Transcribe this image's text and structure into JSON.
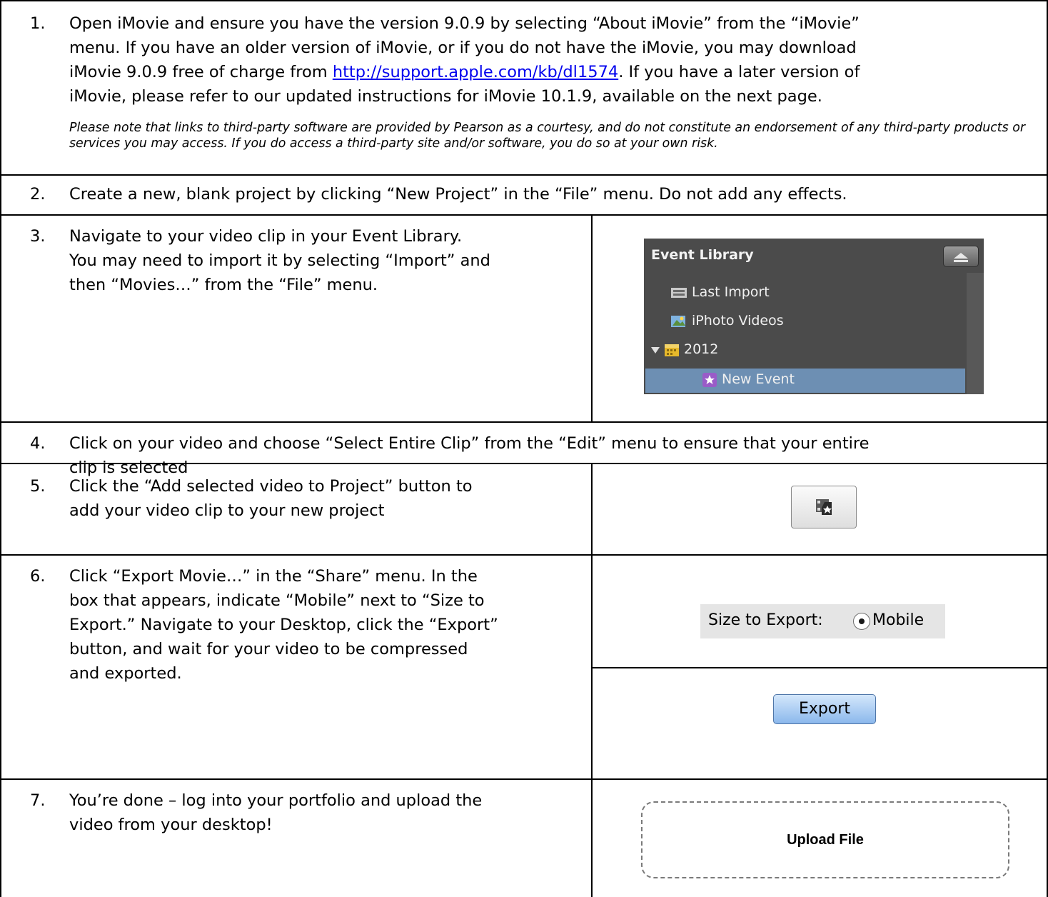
{
  "steps": [
    {
      "number": "1.",
      "line1": "Open iMovie and ensure you have the version 9.0.9 by selecting “About iMovie” from the “iMovie”",
      "line2": "menu. If you have an older version of iMovie, or if you do not have the iMovie, you may download",
      "line3_pre": "iMovie 9.0.9 free of charge from ",
      "link": "http://support.apple.com/kb/dl1574",
      "line3_post": ". If you have a later version of",
      "line4": "iMovie, please refer to our updated instructions for iMovie 10.1.9, available on the next page.",
      "note": "Please note that links to third-party software are provided by Pearson as a courtesy, and do not constitute an endorsement of any third-party products or services you may access. If you do access a third-party site and/or software, you do so at your own risk."
    },
    {
      "number": "2.",
      "line1": "Create a new, blank project by clicking “New Project” in the “File” menu.  Do not add any effects."
    },
    {
      "number": "3.",
      "line1": "Navigate to your video clip in your Event Library.",
      "line2": "You may need to import it by selecting “Import” and",
      "line3": "then “Movies…” from the “File” menu."
    },
    {
      "number": "4.",
      "line1": "Click on your video and choose “Select Entire Clip” from the “Edit” menu to ensure that your entire",
      "line2": "clip is selected"
    },
    {
      "number": "5.",
      "line1": "Click the “Add selected video to Project” button to",
      "line2": "add your video clip to your new project"
    },
    {
      "number": "6.",
      "line1": "Click “Export Movie…” in the “Share” menu.  In the",
      "line2": "box that appears, indicate “Mobile” next to “Size to",
      "line3": "Export.” Navigate to your Desktop, click the “Export”",
      "line4": "button, and wait for your video to be compressed",
      "line5": "and exported."
    },
    {
      "number": "7.",
      "line1": "You’re done – log into your portfolio and upload the",
      "line2": "video from your desktop!"
    }
  ],
  "event_library": {
    "title": "Event Library",
    "items": [
      "Last Import",
      "iPhoto Videos",
      "2012",
      "New Event"
    ]
  },
  "size_export": {
    "label": "Size to Export:",
    "option": "Mobile"
  },
  "export_button": {
    "label": "Export"
  },
  "upload": {
    "label": "Upload File"
  },
  "colors": {
    "link": "#0000ee",
    "selection": "#6d8fb3",
    "panel": "#4b4b4b"
  }
}
